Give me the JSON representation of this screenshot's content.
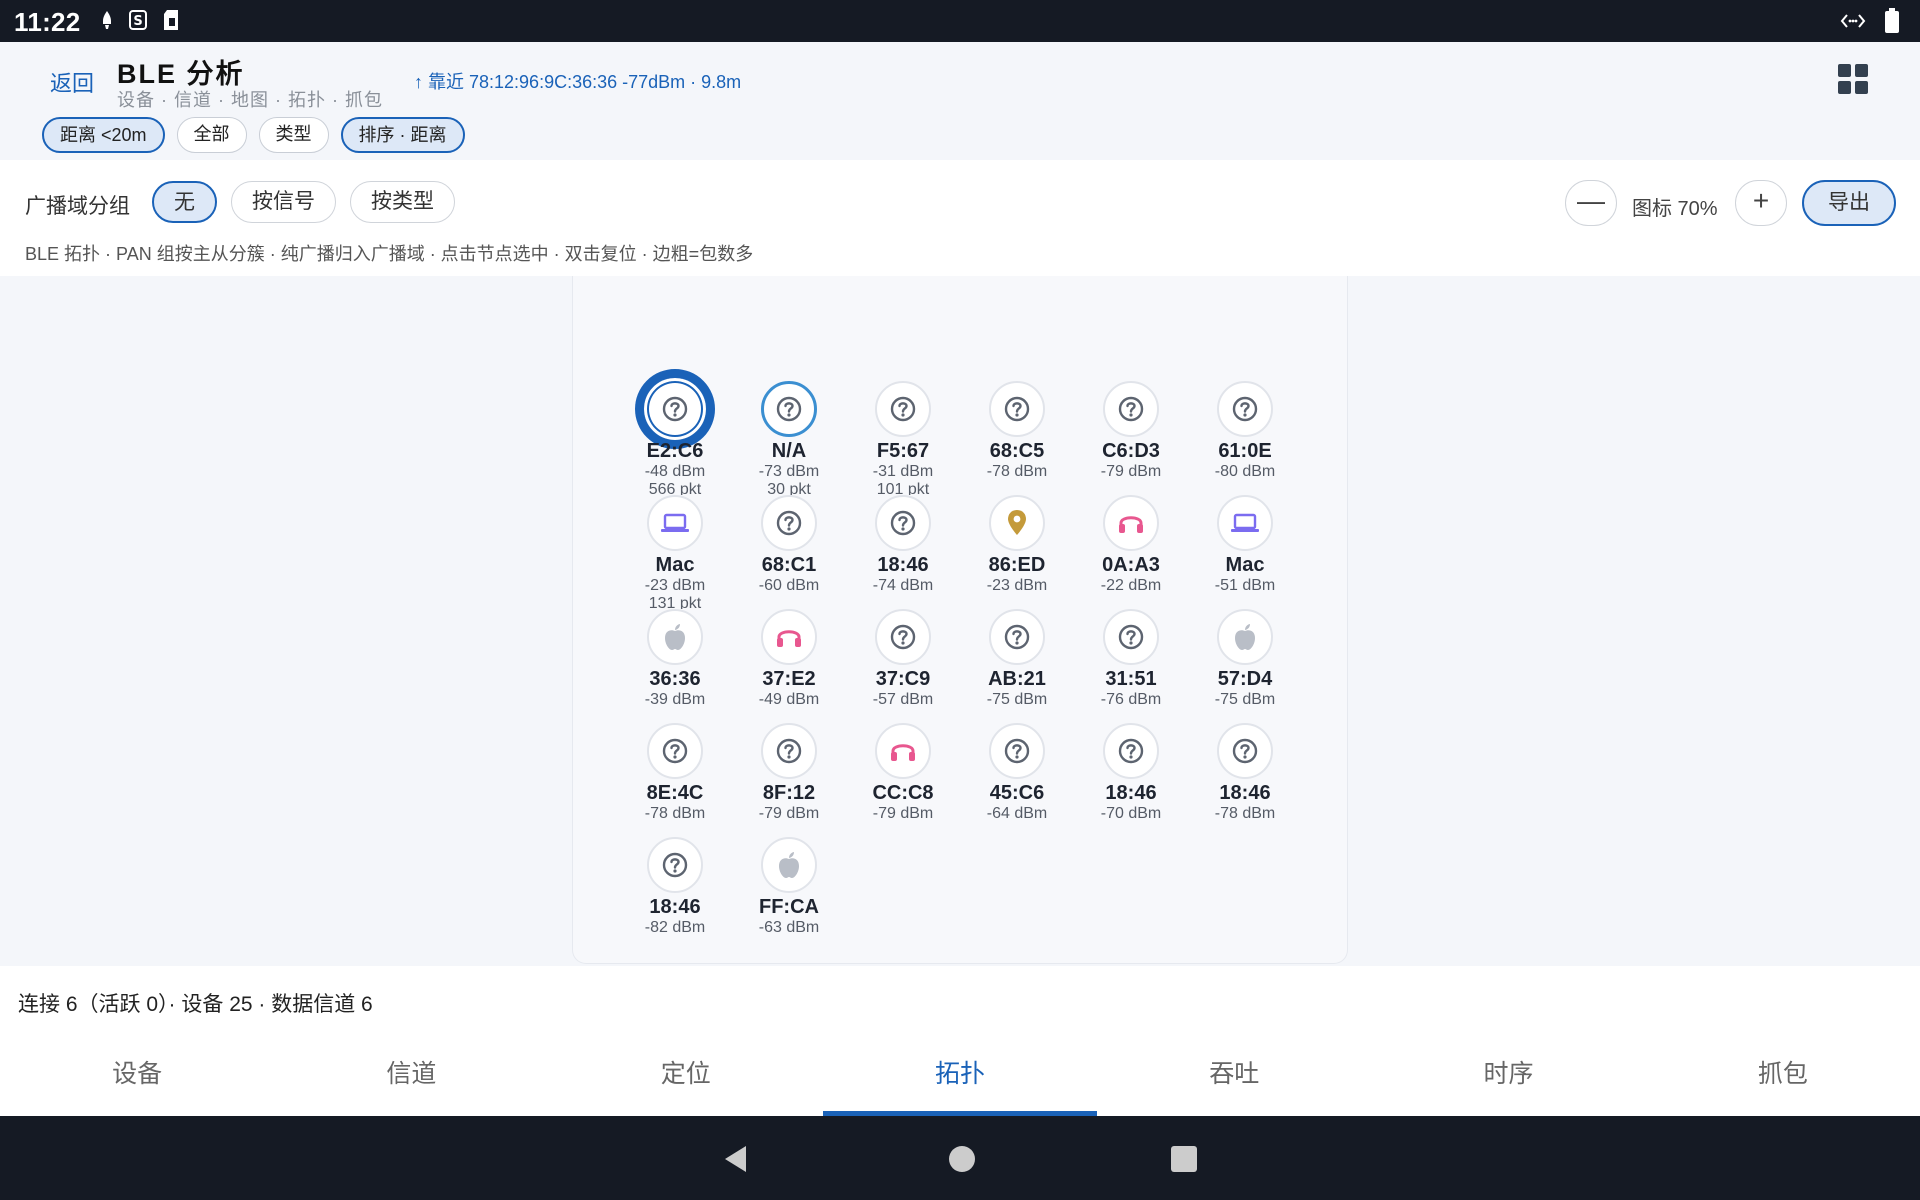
{
  "status_bar": {
    "time": "11:22"
  },
  "header": {
    "back_label": "返回",
    "title": "BLE 分析",
    "subnav": "设备 · 信道 · 地图 · 拓扑 · 抓包",
    "nearest": "↑ 靠近 78:12:96:9C:36:36 -77dBm · 9.8m",
    "chips": [
      {
        "label": "距离 <20m",
        "active": true
      },
      {
        "label": "全部",
        "active": false
      },
      {
        "label": "类型",
        "active": false
      },
      {
        "label": "排序 · 距离",
        "active": true
      }
    ]
  },
  "group_bar": {
    "label": "广播域分组",
    "buttons": [
      {
        "label": "无",
        "active": true
      },
      {
        "label": "按信号",
        "active": false
      },
      {
        "label": "按类型",
        "active": false
      }
    ],
    "zoom_minus": "—",
    "zoom_label": "图标 70%",
    "zoom_plus": "+",
    "export_label": "导出",
    "hint": "BLE 拓扑 · PAN 组按主从分簇 · 纯广播归入广播域 · 点击节点选中 · 双击复位 · 边粗=包数多"
  },
  "nodes": [
    {
      "name": "E2:C6",
      "rssi": "-48 dBm",
      "pkt": "566 pkt",
      "icon": "unknown-icon",
      "selected": true
    },
    {
      "name": "N/A",
      "rssi": "-73 dBm",
      "pkt": "30 pkt",
      "icon": "unknown-icon",
      "ring": true
    },
    {
      "name": "F5:67",
      "rssi": "-31 dBm",
      "pkt": "101 pkt",
      "icon": "unknown-icon"
    },
    {
      "name": "68:C5",
      "rssi": "-78 dBm",
      "pkt": "",
      "icon": "unknown-icon"
    },
    {
      "name": "C6:D3",
      "rssi": "-79 dBm",
      "pkt": "",
      "icon": "unknown-icon"
    },
    {
      "name": "61:0E",
      "rssi": "-80 dBm",
      "pkt": "",
      "icon": "unknown-icon"
    },
    {
      "name": "Mac",
      "rssi": "-23 dBm",
      "pkt": "131 pkt",
      "icon": "laptop-icon"
    },
    {
      "name": "68:C1",
      "rssi": "-60 dBm",
      "pkt": "",
      "icon": "unknown-icon"
    },
    {
      "name": "18:46",
      "rssi": "-74 dBm",
      "pkt": "",
      "icon": "unknown-icon"
    },
    {
      "name": "86:ED",
      "rssi": "-23 dBm",
      "pkt": "",
      "icon": "location-pin-icon"
    },
    {
      "name": "0A:A3",
      "rssi": "-22 dBm",
      "pkt": "",
      "icon": "headphones-icon"
    },
    {
      "name": "Mac",
      "rssi": "-51 dBm",
      "pkt": "",
      "icon": "laptop-icon"
    },
    {
      "name": "36:36",
      "rssi": "-39 dBm",
      "pkt": "",
      "icon": "apple-icon"
    },
    {
      "name": "37:E2",
      "rssi": "-49 dBm",
      "pkt": "",
      "icon": "headphones-icon"
    },
    {
      "name": "37:C9",
      "rssi": "-57 dBm",
      "pkt": "",
      "icon": "unknown-icon"
    },
    {
      "name": "AB:21",
      "rssi": "-75 dBm",
      "pkt": "",
      "icon": "unknown-icon"
    },
    {
      "name": "31:51",
      "rssi": "-76 dBm",
      "pkt": "",
      "icon": "unknown-icon"
    },
    {
      "name": "57:D4",
      "rssi": "-75 dBm",
      "pkt": "",
      "icon": "apple-icon"
    },
    {
      "name": "8E:4C",
      "rssi": "-78 dBm",
      "pkt": "",
      "icon": "unknown-icon"
    },
    {
      "name": "8F:12",
      "rssi": "-79 dBm",
      "pkt": "",
      "icon": "unknown-icon"
    },
    {
      "name": "CC:C8",
      "rssi": "-79 dBm",
      "pkt": "",
      "icon": "headphones-icon"
    },
    {
      "name": "45:C6",
      "rssi": "-64 dBm",
      "pkt": "",
      "icon": "unknown-icon"
    },
    {
      "name": "18:46",
      "rssi": "-70 dBm",
      "pkt": "",
      "icon": "unknown-icon"
    },
    {
      "name": "18:46",
      "rssi": "-78 dBm",
      "pkt": "",
      "icon": "unknown-icon"
    },
    {
      "name": "18:46",
      "rssi": "-82 dBm",
      "pkt": "",
      "icon": "unknown-icon"
    },
    {
      "name": "FF:CA",
      "rssi": "-63 dBm",
      "pkt": "",
      "icon": "apple-icon"
    }
  ],
  "stats": "连接 6（活跃 0）· 设备 25 · 数据信道 6",
  "tabs": [
    {
      "label": "设备",
      "active": false
    },
    {
      "label": "信道",
      "active": false
    },
    {
      "label": "定位",
      "active": false
    },
    {
      "label": "拓扑",
      "active": true
    },
    {
      "label": "吞吐",
      "active": false
    },
    {
      "label": "时序",
      "active": false
    },
    {
      "label": "抓包",
      "active": false
    }
  ],
  "colors": {
    "accent": "#1a62b8",
    "headphones": "#e8578f",
    "laptop": "#7b6cf0",
    "pin": "#c49a3a",
    "apple": "#b9bec7",
    "unknown": "#5d6470"
  }
}
